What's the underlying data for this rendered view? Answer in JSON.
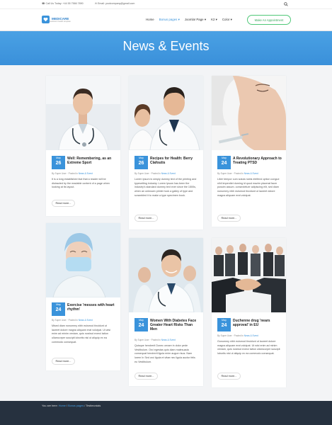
{
  "topbar": {
    "phone": "Call Us Today: +44 55 7566 7890",
    "email": "Email: youtcompany@gmail.com"
  },
  "header": {
    "logo_name": "MEDICARE",
    "logo_tagline": "medical & health template",
    "nav": [
      {
        "label": "Home"
      },
      {
        "label": "Bonus pages ▾"
      },
      {
        "label": "Joomla! Page ▾"
      },
      {
        "label": "K2 ▾"
      },
      {
        "label": "Color ▾"
      }
    ],
    "appointment_label": "Make An Appointment"
  },
  "banner": {
    "title": "News & Events"
  },
  "cards": [
    {
      "month": "May",
      "day": "26",
      "title": "Well: Remembering, as an Extreme Sport",
      "author": "By Super User",
      "posted_in": "Posted in",
      "category": "News & Event",
      "excerpt": "It is a long established fact that a reader will be distracted by the readable content of a page when looking at its layout.",
      "read_more": "Read more..."
    },
    {
      "month": "May",
      "day": "26",
      "title": "Recipes for Health: Berry Clafoutis",
      "author": "By Super User",
      "posted_in": "Posted in",
      "category": "News & Event",
      "excerpt": "Lorem Ipsum is simply dummy text of the printing and typesetting industry. Lorem Ipsum has been the industry's standard dummy text ever since the 1500s, when an unknown printer took a galley of type and scrambled it to make a type specimen book.",
      "read_more": "Read more..."
    },
    {
      "month": "May",
      "day": "24",
      "title": "A Revolutionary Approach to Treating PTSD",
      "author": "By Super User",
      "posted_in": "Posted in",
      "category": "News & Event",
      "excerpt": "Liber tempor cum soluta nobis eleifend option congue nihil imperdiet doming id quod mazim placerat facer possim assum. consectetuer adipiscing elit, sed diam nonummy nibh euismod tincidunt ut laoreet dolore magna aliquam erat volutpat.",
      "read_more": "Read more..."
    },
    {
      "month": "May",
      "day": "24",
      "title": "Exercise 'messes with heart rhythm'",
      "author": "By Super User",
      "posted_in": "Posted in",
      "category": "News & Event",
      "excerpt": "Mised diam nonummy nibh euismod tincidunt ut laoreet dolore magna aliquam erat volutpat. Ut wisi enim ad minim veniam, quis nostrud exerci tation ullamcorper suscipit lobortis nisl ut aliquip ex ea commodo consequat.",
      "read_more": "Read more..."
    },
    {
      "month": "May",
      "day": "24",
      "title": "Women With Diabetes Face Greater Heart Risks Than Men",
      "author": "By Super User",
      "posted_in": "Posted in",
      "category": "News & Event",
      "excerpt": "Quisque hendrerit Donec ornare in dolor pede Vestibulum. Orci egestas quis diam malesuada consequat hendrerit ligula enim augue risus. Nam lorem In Sed orci ligula et vitae nec ligula auctor felis eu Vestibulum.",
      "read_more": "Read more..."
    },
    {
      "month": "May",
      "day": "24",
      "title": "Duchenne drug 'nears approval' in EU",
      "author": "By Super User",
      "posted_in": "Posted in",
      "category": "News & Event",
      "excerpt": "Gonummy nibh euismod tincidunt ut laoreet dolore magna aliquam erat volutpat. Ut wisi enim ad minim veniam, quis nostrud exerci tation ullamcorper suscipit lobortis nisl ut aliquip ex ea commodo consequat.",
      "read_more": "Read more..."
    }
  ],
  "footer": {
    "you_are_here": "You are here:",
    "crumbs": [
      "Home",
      "Bonus pages",
      "Testimonials"
    ],
    "separator": "/"
  },
  "colors": {
    "accent": "#3a93db",
    "footer_bg": "#26313f",
    "appointment_border": "#50c878"
  }
}
